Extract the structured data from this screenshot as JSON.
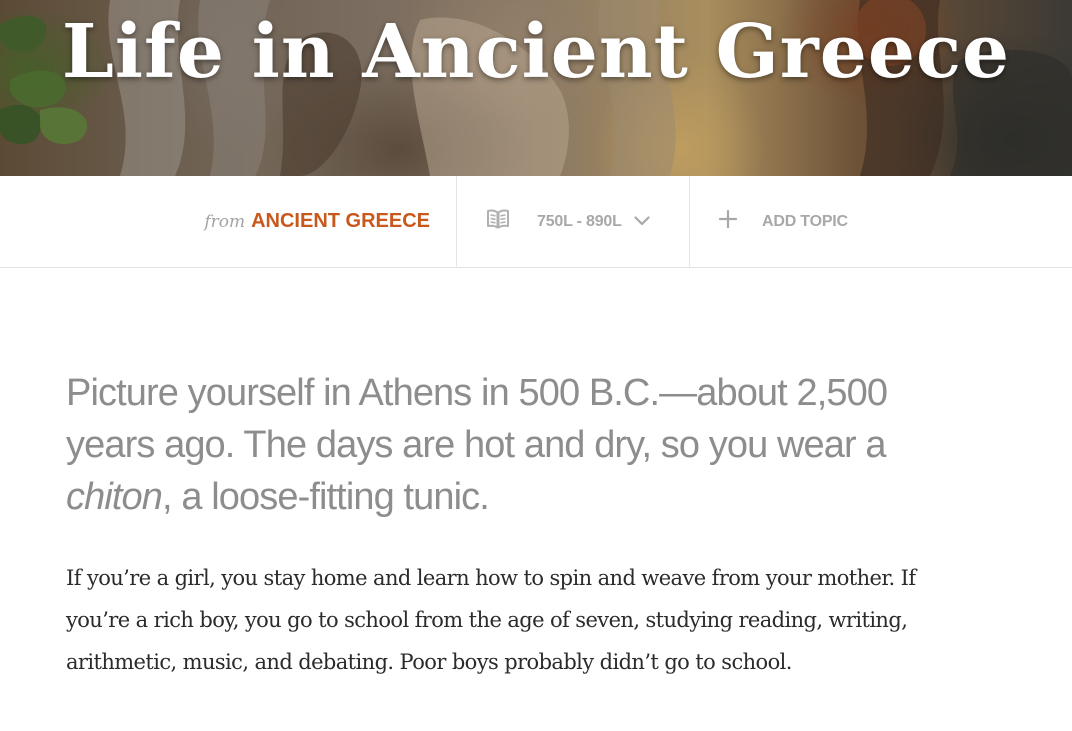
{
  "hero": {
    "title": "Life in Ancient Greece"
  },
  "meta": {
    "source_prefix": "from",
    "source_name": "ANCIENT GREECE",
    "level_icon": "book-icon",
    "reading_level": "750L - 890L",
    "add_topic_icon": "plus-icon",
    "add_topic_label": "ADD TOPIC"
  },
  "article": {
    "lead": {
      "before": "Picture yourself in Athens in 500 B.C.—about 2,500 years ago. The days are hot and dry, so you wear a ",
      "emphasis": "chiton",
      "after": ", a loose-fitting tunic."
    },
    "paragraph": "If you’re a girl, you stay home and learn how to spin and weave from your mother. If you’re a rich boy, you go to school from the age of seven, studying reading, writing, arithmetic, music, and debating. Poor boys probably didn’t go to school."
  },
  "colors": {
    "accent": "#c8581c",
    "muted_text": "#a8a8a8",
    "lead_text": "#8d8d8d",
    "body_text": "#2b2b2b"
  }
}
